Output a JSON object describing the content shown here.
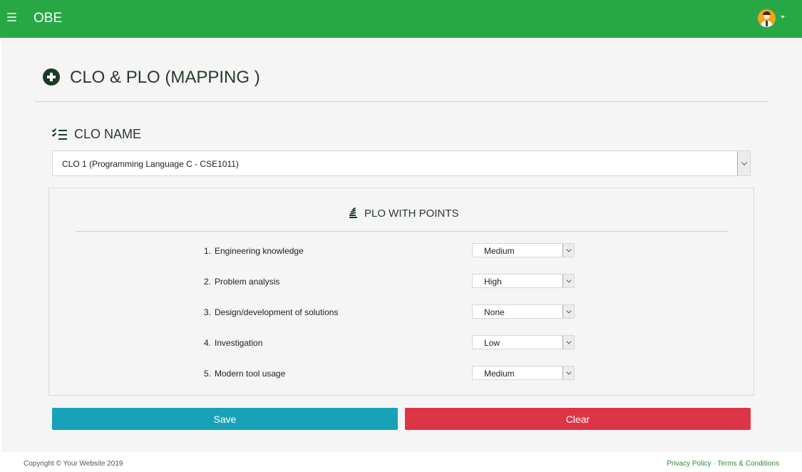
{
  "navbar": {
    "brand": "OBE",
    "bg_color": "#28a745",
    "menu_icon": "hamburger-menu-icon",
    "avatar_icon": "user-avatar-icon"
  },
  "page": {
    "title": "CLO & PLO (MAPPING )",
    "title_icon": "plus-circle-icon"
  },
  "clo": {
    "label": "CLO NAME",
    "label_icon": "list-check-icon",
    "selected": "CLO 1 (Programming Language C - CSE1011)"
  },
  "plo_section": {
    "title": "PLO WITH POINTS",
    "title_icon": "stack-icon",
    "items": [
      {
        "num": "1.",
        "name": "Engineering knowledge",
        "level": "Medium"
      },
      {
        "num": "2.",
        "name": "Problem analysis",
        "level": "High"
      },
      {
        "num": "3.",
        "name": "Design/development of solutions",
        "level": "None"
      },
      {
        "num": "4.",
        "name": "Investigation",
        "level": "Low"
      },
      {
        "num": "5.",
        "name": "Modern tool usage",
        "level": "Medium"
      }
    ]
  },
  "actions": {
    "save_label": "Save",
    "clear_label": "Clear",
    "save_color": "#17a2b8",
    "clear_color": "#dc3545"
  },
  "footer": {
    "copyright": "Copyright © Your Website 2019",
    "privacy": "Privacy Policy",
    "separator": "·",
    "terms": "Terms & Conditions"
  }
}
